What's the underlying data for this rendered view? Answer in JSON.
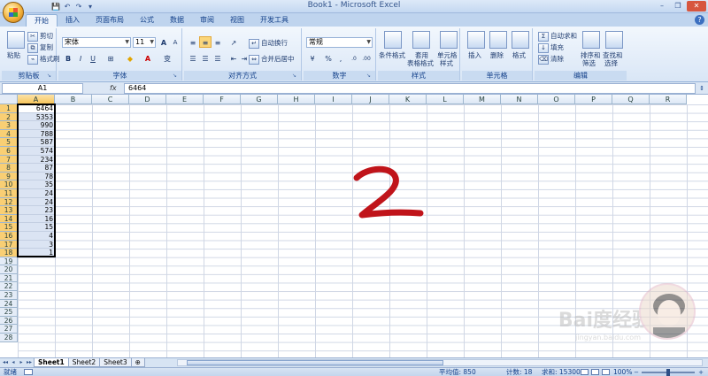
{
  "window": {
    "title": "Book1 - Microsoft Excel",
    "controls": {
      "minimize": "–",
      "restore": "❐",
      "close": "✕"
    }
  },
  "qat": {
    "save": "💾",
    "undo": "↶",
    "redo": "↷",
    "dropdown": "▾"
  },
  "tabs": [
    "开始",
    "插入",
    "页面布局",
    "公式",
    "数据",
    "审阅",
    "视图",
    "开发工具"
  ],
  "active_tab": "开始",
  "help": "?",
  "ribbon": {
    "clipboard": {
      "label": "剪贴板",
      "paste": "粘贴",
      "cut": "剪切",
      "copy": "复制",
      "format_painter": "格式刷"
    },
    "font": {
      "label": "字体",
      "font_name": "宋体",
      "font_size": "11",
      "bold": "B",
      "italic": "I",
      "underline": "U",
      "grow": "A",
      "shrink": "A",
      "phonetic": "变"
    },
    "alignment": {
      "label": "对齐方式",
      "wrap_text": "自动换行",
      "merge_center": "合并后居中"
    },
    "number": {
      "label": "数字",
      "format": "常规",
      "percent": "%",
      "comma": ",",
      "inc_decimal": ".0",
      "dec_decimal": ".00"
    },
    "styles": {
      "label": "样式",
      "conditional": "条件格式",
      "table_format_1": "套用",
      "table_format_2": "表格格式",
      "cell_styles_1": "单元格",
      "cell_styles_2": "样式"
    },
    "cells": {
      "label": "单元格",
      "insert": "插入",
      "delete": "删除",
      "format": "格式"
    },
    "editing": {
      "label": "编辑",
      "autosum": "自动求和",
      "fill": "填充",
      "clear": "清除",
      "sort_1": "排序和",
      "sort_2": "筛选",
      "find_1": "查找和",
      "find_2": "选择"
    }
  },
  "formula_bar": {
    "name_box": "A1",
    "fx": "fx",
    "value": "6464"
  },
  "columns": [
    "A",
    "B",
    "C",
    "D",
    "E",
    "F",
    "G",
    "H",
    "I",
    "J",
    "K",
    "L",
    "M",
    "N",
    "O",
    "P",
    "Q",
    "R"
  ],
  "rows": [
    "1",
    "2",
    "3",
    "4",
    "5",
    "6",
    "7",
    "8",
    "9",
    "10",
    "11",
    "12",
    "13",
    "14",
    "15",
    "16",
    "17",
    "18",
    "19",
    "20",
    "21",
    "22",
    "23",
    "24",
    "25",
    "26",
    "27",
    "28"
  ],
  "column_a_values": [
    "6464",
    "5353",
    "990",
    "788",
    "587",
    "574",
    "234",
    "87",
    "78",
    "35",
    "24",
    "24",
    "23",
    "16",
    "15",
    "4",
    "3",
    "1"
  ],
  "handwriting": "2",
  "sheet_tabs": [
    "Sheet1",
    "Sheet2",
    "Sheet3"
  ],
  "sheet_nav": [
    "◂◂",
    "◂",
    "▸",
    "▸▸"
  ],
  "status": {
    "ready": "就绪",
    "average": "平均值: 850",
    "count": "计数: 18",
    "sum": "求和: 15300",
    "zoom": "100%",
    "zoom_minus": "−",
    "zoom_plus": "+"
  },
  "watermark": {
    "text": "Bai度经验",
    "sub": "jingyan.baidu.com"
  },
  "colors": {
    "accent": "#15428b",
    "ribbon_bg": "#d9e6f6",
    "selection_header": "#f8c65c",
    "handwriting": "#c0141a"
  }
}
